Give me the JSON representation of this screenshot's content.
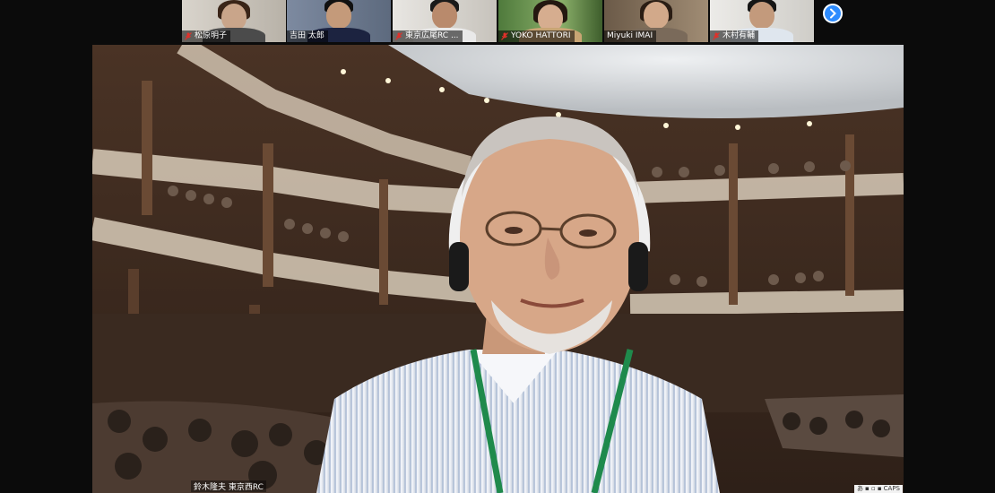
{
  "gallery": {
    "participants": [
      {
        "name": "松原明子",
        "muted": true
      },
      {
        "name": "吉田 太郎",
        "muted": false
      },
      {
        "name": "東京広尾RC ...",
        "muted": true
      },
      {
        "name": "YOKO HATTORI",
        "muted": true
      },
      {
        "name": "Miyuki IMAI",
        "muted": false
      },
      {
        "name": "木村有輔",
        "muted": true
      }
    ],
    "next_page_icon": "chevron-right-icon"
  },
  "active_speaker": {
    "name": "鈴木隆夫 東京西RC",
    "virtual_background": "theatre-interior"
  },
  "system_tray": {
    "ime": "あ",
    "caps": "CAPS"
  },
  "colors": {
    "accent": "#2d8cff",
    "muted_mic": "#e0302a",
    "background": "#0b0b0b"
  }
}
